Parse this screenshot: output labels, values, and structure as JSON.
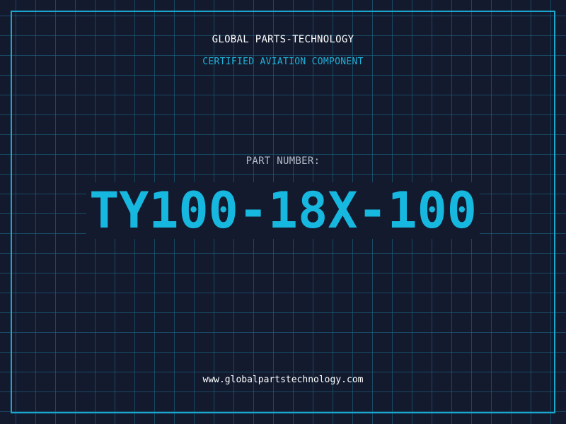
{
  "header": {
    "company": "GLOBAL PARTS-TECHNOLOGY",
    "subtitle": "CERTIFIED AVIATION COMPONENT"
  },
  "part": {
    "label": "PART NUMBER:",
    "number": "TY100-18X-100"
  },
  "footer": {
    "website": "www.globalpartstechnology.com"
  },
  "colors": {
    "background": "#131a2e",
    "grid": "#1c6e8c",
    "accent": "#17b8e0",
    "frame": "#1aa7cf",
    "label": "#b4bcc8",
    "text": "#ffffff"
  }
}
